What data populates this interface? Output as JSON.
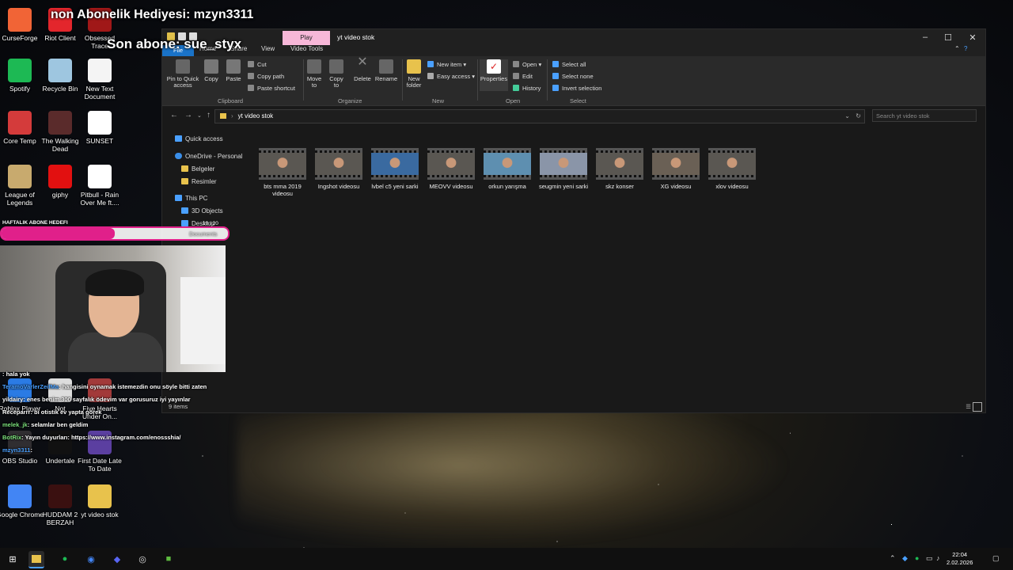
{
  "overlay": {
    "gift_banner": "non Abonelik Hediyesi: mzyn3311",
    "sub_banner": "Son abone: sue_styx",
    "goal_label": "HAFTALIK ABONE HEDEFI",
    "goal_count": "10 / 20",
    "goal_progress": 0.5,
    "cam_text": "Documents"
  },
  "desktop_icons": [
    {
      "label": "CurseForge",
      "color": "#f16436"
    },
    {
      "label": "Riot Client",
      "color": "#e3262c"
    },
    {
      "label": "Obsessed Trace",
      "color": "#a01818"
    },
    {
      "label": "Spotify",
      "color": "#1db954"
    },
    {
      "label": "Recycle Bin",
      "color": "#9ec6e0"
    },
    {
      "label": "New Text Document",
      "color": "#f4f4f4"
    },
    {
      "label": "Core Temp",
      "color": "#d43b3b"
    },
    {
      "label": "The Walking Dead",
      "color": "#5a2b2b"
    },
    {
      "label": "SUNSET",
      "color": "#ffffff"
    },
    {
      "label": "League of Legends",
      "color": "#c8aa6e"
    },
    {
      "label": "giphy",
      "color": "#e21010"
    },
    {
      "label": "Pitbull - Rain Over Me ft....",
      "color": "#ffffff"
    },
    {
      "label": "Roblox Player",
      "color": "#2b7be4"
    },
    {
      "label": "Not",
      "color": "#dddddd"
    },
    {
      "label": "Five Hearts Under On...",
      "color": "#a23a3a"
    },
    {
      "label": "OBS Studio",
      "color": "#302e31"
    },
    {
      "label": "Undertale",
      "color": "#111111"
    },
    {
      "label": "First Date Late To Date",
      "color": "#5b3fa0"
    },
    {
      "label": "Google Chrome",
      "color": "#4285f4"
    },
    {
      "label": "HUDDAM 2 BERZAH",
      "color": "#3a1010"
    },
    {
      "label": "yt video stok",
      "color": "#e8c24c"
    }
  ],
  "explorer": {
    "title": "yt video stok",
    "context_tab": "Play",
    "tabs": {
      "file": "File",
      "home": "Home",
      "share": "Share",
      "view": "View",
      "video_tools": "Video Tools"
    },
    "ribbon": {
      "pin": "Pin to Quick access",
      "copy": "Copy",
      "paste": "Paste",
      "cut": "Cut",
      "copy_path": "Copy path",
      "paste_shortcut": "Paste shortcut",
      "move_to": "Move to",
      "copy_to": "Copy to",
      "delete": "Delete",
      "rename": "Rename",
      "new_folder": "New folder",
      "new_item": "New item",
      "easy_access": "Easy access",
      "properties": "Properties",
      "open": "Open",
      "edit": "Edit",
      "history": "History",
      "select_all": "Select all",
      "select_none": "Select none",
      "invert_selection": "Invert selection",
      "groups": {
        "clipboard": "Clipboard",
        "organize": "Organize",
        "new": "New",
        "open": "Open",
        "select": "Select"
      }
    },
    "address": "yt video stok",
    "search_placeholder": "Search yt video stok",
    "nav": {
      "quick_access": "Quick access",
      "onedrive": "OneDrive - Personal",
      "belgeler": "Belgeler",
      "resimler": "Resimler",
      "this_pc": "This PC",
      "objects3d": "3D Objects",
      "desktop": "Desktop"
    },
    "files": [
      {
        "name": "bts mma 2019 videosu",
        "tone": "#5a5752"
      },
      {
        "name": "Ingshot videosu",
        "tone": "#5a5752"
      },
      {
        "name": "lvbel c5 yeni sarki",
        "tone": "#3a6aa0"
      },
      {
        "name": "MEOVV videosu",
        "tone": "#5a5752"
      },
      {
        "name": "orkun yarışma",
        "tone": "#5e8fb0"
      },
      {
        "name": "seugmin yeni sarki",
        "tone": "#8a95a8"
      },
      {
        "name": "skz konser",
        "tone": "#5a5752"
      },
      {
        "name": "XG videosu",
        "tone": "#6a6055"
      },
      {
        "name": "xlov videosu",
        "tone": "#5a5752"
      }
    ],
    "status": "9 items"
  },
  "chat": [
    {
      "user": "",
      "msg": ": hala yok",
      "color": "#4aa0ff"
    },
    {
      "user": "TeramoVarlerZeifMa",
      "msg": ": hangisini oynamak istemezdin onu söyle bitti zaten",
      "color": "#4aa0ff"
    },
    {
      "user": "yildairy",
      "msg": ": enes benim 300 sayfalık ödevim var gorusuruz iyi yayınlar",
      "color": "#ffffff"
    },
    {
      "user": "Receparrr",
      "msg": ": bi otistik ev yapta görek",
      "color": "#ffffff"
    },
    {
      "user": "melek_jk",
      "msg": ": selamlar ben geldim",
      "color": "#7be07b"
    },
    {
      "user": "BotRix",
      "msg": ": Yayın duyurları: https://www.instagram.com/enossshia/",
      "color": "#7be07b"
    },
    {
      "user": "mzyn3311",
      "msg": ":",
      "color": "#4aa0ff"
    }
  ],
  "taskbar": {
    "time": "22:04",
    "date": "2.02.2026"
  }
}
